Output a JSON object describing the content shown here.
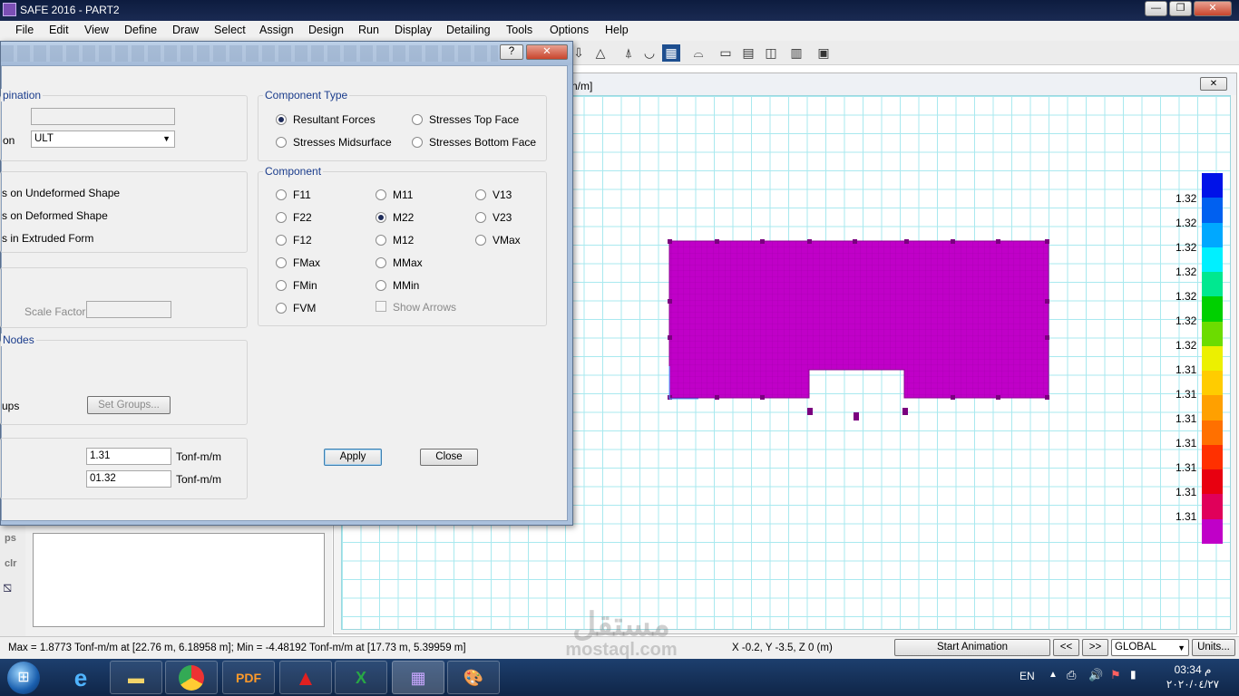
{
  "window": {
    "title": "SAFE 2016 - PART2",
    "min": "—",
    "max": "❐",
    "close": "✕"
  },
  "menu": [
    "File",
    "Edit",
    "View",
    "Define",
    "Draw",
    "Select",
    "Assign",
    "Design",
    "Run",
    "Display",
    "Detailing",
    "Tools",
    "Options",
    "Help"
  ],
  "view": {
    "title_fragment": "n/m]",
    "close": "✕"
  },
  "legend": {
    "labels": [
      "1.32",
      "1.32",
      "1.32",
      "1.32",
      "1.32",
      "1.32",
      "1.32",
      "1.31",
      "1.31",
      "1.31",
      "1.31",
      "1.31",
      "1.31",
      "1.31"
    ],
    "colors": [
      "#0012e8",
      "#0060f0",
      "#00a8ff",
      "#00f0ff",
      "#00e890",
      "#00d000",
      "#6cdc00",
      "#ecf000",
      "#ffcc00",
      "#ffa000",
      "#ff7000",
      "#ff3000",
      "#e80010",
      "#e0005a",
      "#c000c8"
    ]
  },
  "status": {
    "maxmin": "Max = 1.8773 Tonf-m/m at [22.76 m, 6.18958 m];  Min = -4.48192 Tonf-m/m at [17.73 m, 5.39959 m]",
    "coords": "X -0.2,  Y -3.5,  Z 0  (m)",
    "start_animation": "Start Animation",
    "prev": "<<",
    "next": ">>",
    "coord_system": "GLOBAL",
    "units": "Units..."
  },
  "left_panel": {
    "ps": "ps",
    "clr": "clr"
  },
  "dialog": {
    "help": "?",
    "close": "✕",
    "group_combination": {
      "title": "pination",
      "combo_label": "on",
      "combo_value": "ULT"
    },
    "group_display": {
      "options": [
        "s on Undeformed Shape",
        "s on Deformed Shape",
        "s in Extruded Form"
      ]
    },
    "group_scale": {
      "label": "Scale Factor"
    },
    "group_nodes": {
      "title": "Nodes",
      "label": "ups",
      "button": "Set Groups..."
    },
    "range": {
      "min": "1.31",
      "max": "01.32",
      "unit": "Tonf-m/m"
    },
    "component_type": {
      "title": "Component Type",
      "options": [
        "Resultant Forces",
        "Stresses Top Face",
        "Stresses Midsurface",
        "Stresses Bottom Face"
      ],
      "selected": "Resultant Forces"
    },
    "component": {
      "title": "Component",
      "col1": [
        "F11",
        "F22",
        "F12",
        "FMax",
        "FMin",
        "FVM"
      ],
      "col2": [
        "M11",
        "M22",
        "M12",
        "MMax",
        "MMin"
      ],
      "col3": [
        "V13",
        "V23",
        "VMax"
      ],
      "selected": "M22",
      "show_arrows": "Show Arrows"
    },
    "apply": "Apply",
    "close_btn": "Close"
  },
  "taskbar": {
    "lang": "EN",
    "time": "03:34 م",
    "date": "٢٠٢٠/٠٤/٢٧"
  },
  "watermark": {
    "text": "مستقل",
    "url": "mostaql.com"
  },
  "icons": [
    "windows-start-icon",
    "ie-icon",
    "folder-icon",
    "chrome-icon",
    "pdf-icon",
    "autocad-icon",
    "excel-icon",
    "safe-icon",
    "paint-icon"
  ]
}
